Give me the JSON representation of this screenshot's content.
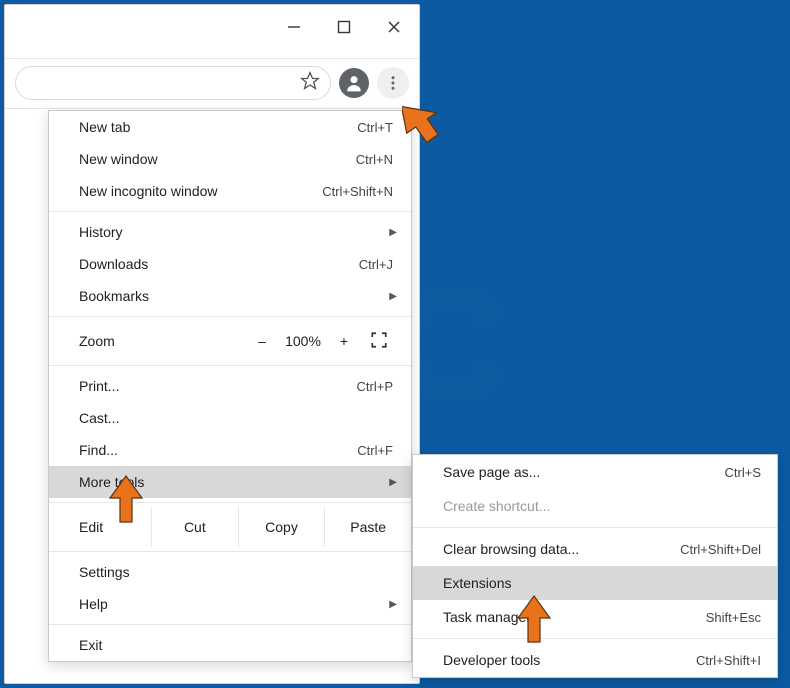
{
  "window": {
    "minimize": "–",
    "maximize": "▢",
    "close": "×"
  },
  "toolbar": {
    "star_title": "Bookmark",
    "profile_title": "Profile",
    "more_title": "Customize and control"
  },
  "menu": {
    "new_tab": "New tab",
    "new_tab_accel": "Ctrl+T",
    "new_window": "New window",
    "new_window_accel": "Ctrl+N",
    "incognito": "New incognito window",
    "incognito_accel": "Ctrl+Shift+N",
    "history": "History",
    "downloads": "Downloads",
    "downloads_accel": "Ctrl+J",
    "bookmarks": "Bookmarks",
    "zoom_label": "Zoom",
    "zoom_minus": "–",
    "zoom_pct": "100%",
    "zoom_plus": "+",
    "print": "Print...",
    "print_accel": "Ctrl+P",
    "cast": "Cast...",
    "find": "Find...",
    "find_accel": "Ctrl+F",
    "more_tools": "More tools",
    "edit_label": "Edit",
    "cut": "Cut",
    "copy": "Copy",
    "paste": "Paste",
    "settings": "Settings",
    "help": "Help",
    "exit": "Exit"
  },
  "submenu": {
    "save_page": "Save page as...",
    "save_page_accel": "Ctrl+S",
    "create_shortcut": "Create shortcut...",
    "clear_data": "Clear browsing data...",
    "clear_data_accel": "Ctrl+Shift+Del",
    "extensions": "Extensions",
    "task_manager": "Task manager",
    "task_manager_accel": "Shift+Esc",
    "dev_tools": "Developer tools",
    "dev_tools_accel": "Ctrl+Shift+I"
  }
}
